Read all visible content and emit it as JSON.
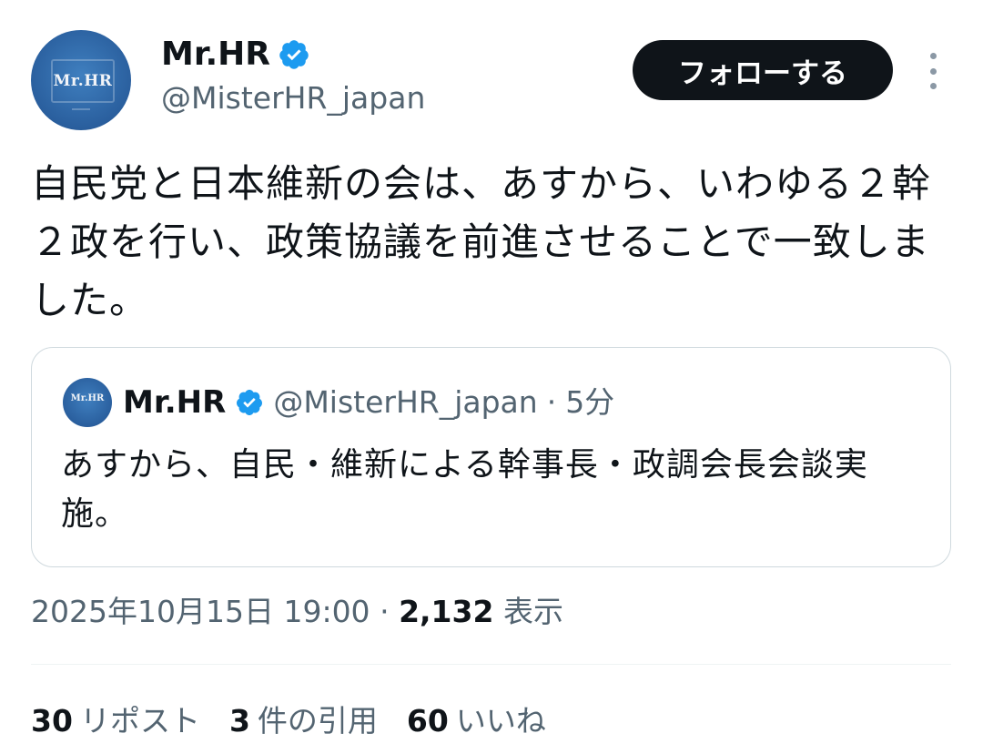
{
  "author": {
    "display_name": "Mr.HR",
    "handle": "@MisterHR_japan",
    "avatar_text": "Mr.HR",
    "verified": true
  },
  "follow_button": "フォローする",
  "more_icon": "more-vertical-icon",
  "tweet_text": "自民党と日本維新の会は、あすから、いわゆる２幹２政を行い、政策協議を前進させることで一致しました。",
  "quoted": {
    "display_name": "Mr.HR",
    "handle": "@MisterHR_japan",
    "separator": "·",
    "time": "5分",
    "text": "あすから、自民・維新による幹事長・政調会長会談実施。",
    "avatar_text": "Mr.HR"
  },
  "meta": {
    "timestamp": "2025年10月15日 19:00",
    "separator": "·",
    "views_count": "2,132",
    "views_label": "表示"
  },
  "stats": {
    "reposts_count": "30",
    "reposts_label": "リポスト",
    "quotes_count": "3",
    "quotes_label": "件の引用",
    "likes_count": "60",
    "likes_label": "いいね"
  },
  "colors": {
    "verified_blue": "#1d9bf0",
    "follow_bg": "#0f1419",
    "secondary_text": "#536471",
    "border": "#cfd9de"
  }
}
